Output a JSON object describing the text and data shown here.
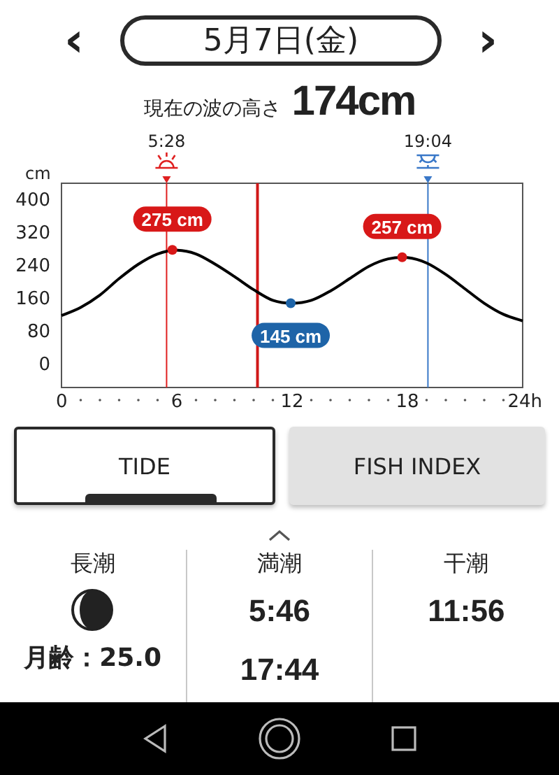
{
  "date_nav": {
    "prev": "‹",
    "date": "5月7日(金)",
    "next": "›"
  },
  "wave": {
    "label": "現在の波の高さ",
    "value": "174cm"
  },
  "tide_chart": {
    "chart_data": {
      "type": "line",
      "ylabel": "cm",
      "x": [
        0,
        1,
        2,
        3,
        4,
        5,
        6,
        7,
        8,
        9,
        10,
        11,
        12,
        13,
        14,
        15,
        16,
        17,
        18,
        19,
        20,
        21,
        22,
        23,
        24
      ],
      "series": [
        {
          "color": "#000000",
          "values": [
            115,
            135,
            165,
            205,
            240,
            265,
            274,
            265,
            240,
            210,
            178,
            152,
            145,
            152,
            175,
            205,
            235,
            253,
            256,
            243,
            215,
            180,
            145,
            118,
            102
          ]
        }
      ],
      "xlim": [
        0,
        24
      ],
      "ylim": [
        -60,
        437
      ],
      "xticks": [
        0,
        6,
        12,
        18,
        {
          "value": 24,
          "label": "24h"
        }
      ],
      "yticks": [
        0,
        80,
        160,
        240,
        320,
        400
      ],
      "ref_lines": [
        {
          "axis": "x",
          "value": 5.47,
          "color": "#e02020"
        },
        {
          "axis": "x",
          "value": 19.07,
          "color": "#3a78c8"
        },
        {
          "axis": "x",
          "value": 10.2,
          "color": "#d01818"
        }
      ],
      "annotations": [
        {
          "x": 5.77,
          "y": 275,
          "text": "275 cm"
        },
        {
          "x": 11.93,
          "y": 145,
          "text": "145 cm"
        },
        {
          "x": 17.73,
          "y": 257,
          "text": "257 cm"
        }
      ]
    },
    "sun": [
      {
        "kind": "sunrise",
        "time": "5:28"
      },
      {
        "kind": "sunset",
        "time": "19:04"
      }
    ]
  },
  "tabs": [
    {
      "label": "TIDE",
      "selected": true
    },
    {
      "label": "FISH INDEX",
      "selected": false
    }
  ],
  "columns": [
    {
      "kind": "moon",
      "title": "長潮",
      "text": "月齢：25.0"
    },
    {
      "kind": "times",
      "title": "満潮",
      "times": [
        "5:46",
        "17:44"
      ]
    },
    {
      "kind": "times",
      "title": "干潮",
      "times": [
        "11:56"
      ]
    }
  ]
}
